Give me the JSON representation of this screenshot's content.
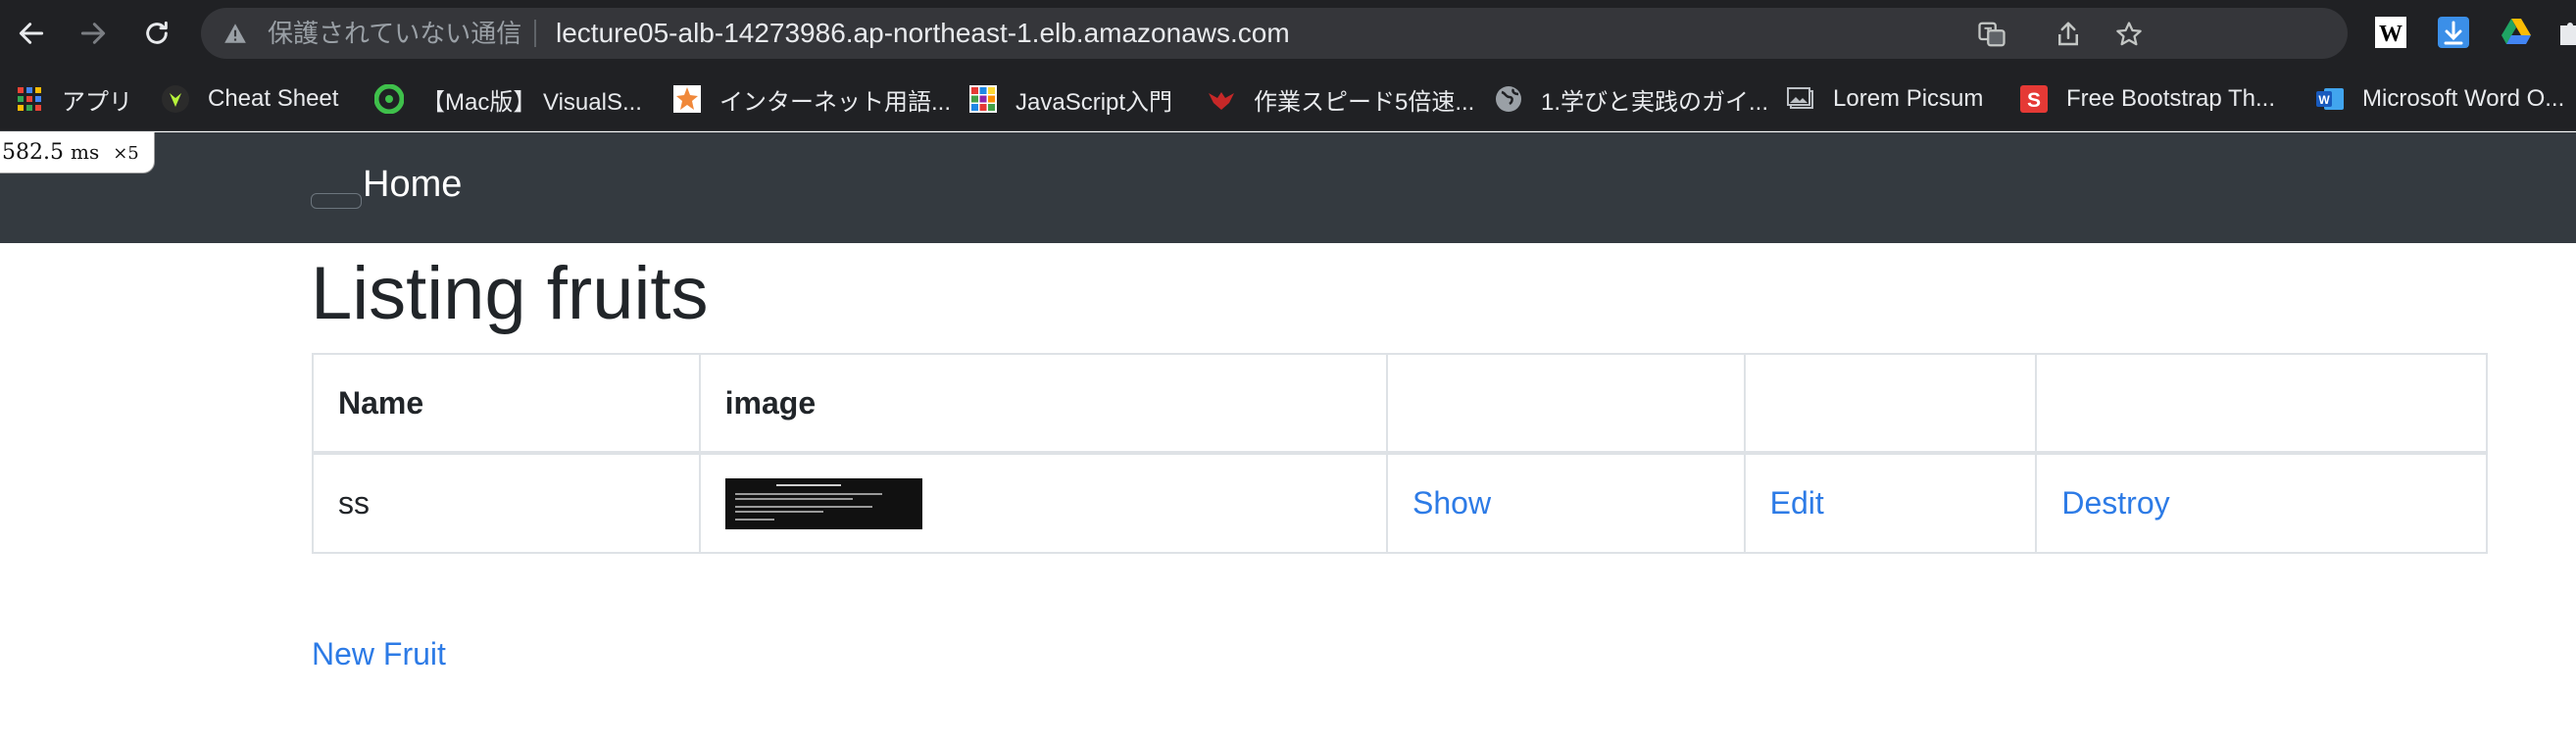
{
  "browser": {
    "security_label": "保護されていない通信",
    "url": "lecture05-alb-14273986.ap-northeast-1.elb.amazonaws.com",
    "bookmarks": [
      {
        "label": "アプリ",
        "icon": "apps-grid-icon"
      },
      {
        "label": "Cheat Sheet",
        "icon": "cheat-sheet-icon"
      },
      {
        "label": "【Mac版】 VisualS...",
        "icon": "green-circle-icon"
      },
      {
        "label": "インターネット用語...",
        "icon": "orange-star-icon"
      },
      {
        "label": "JavaScript入門",
        "icon": "color-grid-icon"
      },
      {
        "label": "作業スピード5倍速...",
        "icon": "red-bird-icon"
      },
      {
        "label": "1.学びと実践のガイ...",
        "icon": "globe-icon"
      },
      {
        "label": "Lorem Picsum",
        "icon": "image-icon"
      },
      {
        "label": "Free Bootstrap Th...",
        "icon": "s-logo-icon"
      },
      {
        "label": "Microsoft Word O...",
        "icon": "word-icon"
      }
    ]
  },
  "overlay": {
    "value": "582.5",
    "unit": "ms",
    "multiplier": "×5"
  },
  "navbar": {
    "home_label": "Home"
  },
  "page": {
    "title": "Listing fruits",
    "table": {
      "headers": [
        "Name",
        "image",
        "",
        "",
        ""
      ],
      "rows": [
        {
          "name": "ss",
          "show": "Show",
          "edit": "Edit",
          "destroy": "Destroy"
        }
      ]
    },
    "new_link": "New Fruit"
  },
  "colors": {
    "navbar_bg": "#343a40",
    "link": "#2d7be6",
    "chrome_bg": "#202124"
  }
}
